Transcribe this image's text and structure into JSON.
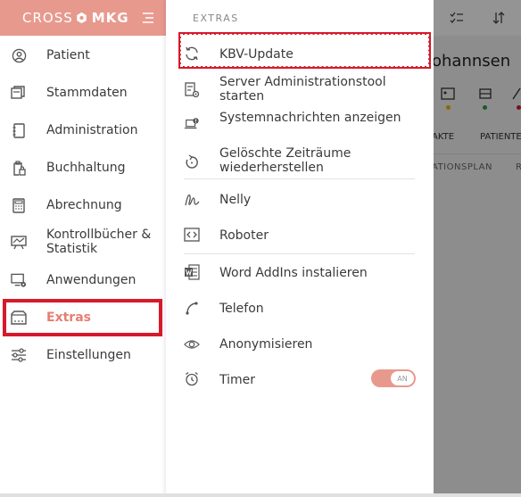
{
  "brand": {
    "cross": "CROSS",
    "mkg": "MKG"
  },
  "colors": {
    "accent": "#e8998e",
    "accent_text": "#e57f72",
    "highlight": "#d7192a"
  },
  "sidebar": {
    "items": [
      {
        "label": "Patient",
        "icon": "user-circle-icon"
      },
      {
        "label": "Stammdaten",
        "icon": "stacked-pages-icon"
      },
      {
        "label": "Administration",
        "icon": "notebook-icon"
      },
      {
        "label": "Buchhaltung",
        "icon": "clipboard-lock-icon"
      },
      {
        "label": "Abrechnung",
        "icon": "calculator-icon"
      },
      {
        "label": "Kontrollbücher & Statistik",
        "icon": "chart-board-icon"
      },
      {
        "label": "Anwendungen",
        "icon": "monitor-gear-icon"
      },
      {
        "label": "Extras",
        "icon": "folder-dots-icon",
        "active": true
      },
      {
        "label": "Einstellungen",
        "icon": "sliders-icon"
      }
    ]
  },
  "panel": {
    "title": "EXTRAS",
    "items": [
      {
        "label": "KBV-Update",
        "icon": "refresh-icon"
      },
      {
        "label": "Server Administrationstool starten",
        "icon": "server-settings-icon"
      },
      {
        "label": "Systemnachrichten anzeigen",
        "icon": "laptop-alert-icon"
      },
      {
        "label": "Gelöschte Zeiträume wiederherstellen",
        "icon": "restore-icon"
      },
      {
        "label": "Nelly",
        "icon": "nelly-signature-icon"
      },
      {
        "label": "Roboter",
        "icon": "code-box-icon"
      },
      {
        "label": "Word AddIns instalieren",
        "icon": "word-icon"
      },
      {
        "label": "Telefon",
        "icon": "phone-icon"
      },
      {
        "label": "Anonymisieren",
        "icon": "eye-icon"
      },
      {
        "label": "Timer",
        "icon": "alarm-clock-icon"
      }
    ],
    "timer_toggle": "AN"
  },
  "background": {
    "title": "ohannsen",
    "tabs": [
      "AKTE",
      "PATIENTE"
    ],
    "sub_tabs": [
      "ATIONSPLAN",
      "R"
    ]
  }
}
